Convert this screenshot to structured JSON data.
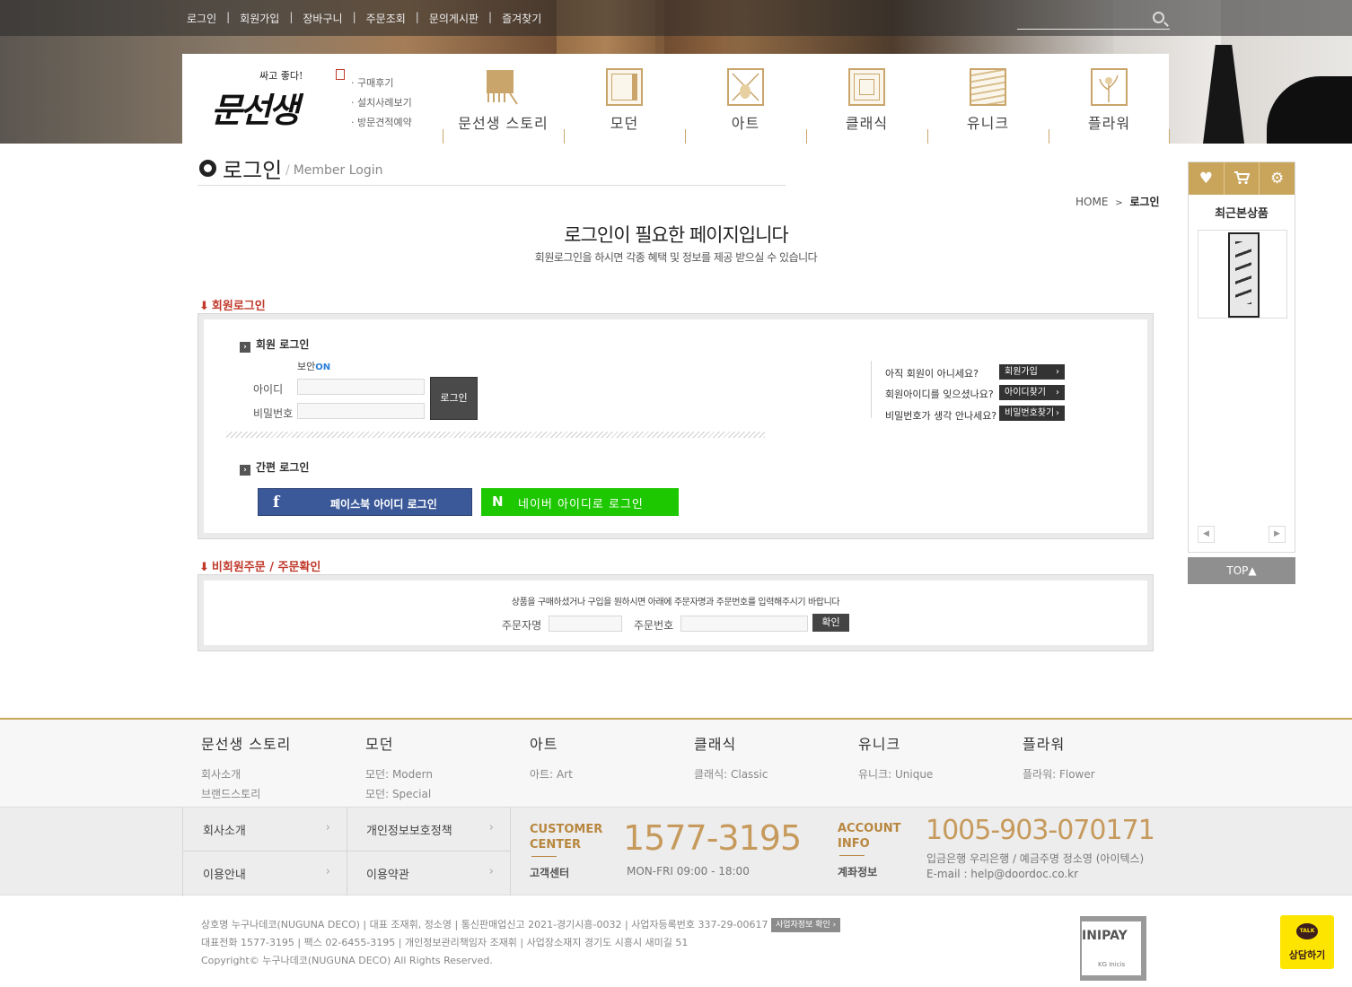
{
  "topnav": {
    "items": [
      "로그인",
      "회원가입",
      "장바구니",
      "주문조회",
      "문의게시판",
      "즐겨찾기"
    ],
    "search_placeholder": ""
  },
  "brand": {
    "slogan": "싸고 좋다!",
    "name": "문선생"
  },
  "quicklinks": [
    "· 구매후기",
    "· 설치사례보기",
    "· 방문견적예약"
  ],
  "categories": [
    "문선생 스토리",
    "모던",
    "아트",
    "클래식",
    "유니크",
    "플라워"
  ],
  "page": {
    "title_ko": "로그인",
    "title_en": "Member Login",
    "title_en_sep": "/",
    "breadcrumb_home": "HOME",
    "breadcrumb_sep": ">",
    "breadcrumb_current": "로그인",
    "headline": "로그인이 필요한 페이지입니다",
    "subline": "회원로그인을 하시면 각종 혜택 및 정보를 제공 받으실 수 있습니다"
  },
  "member_login": {
    "section_label": "회원로그인",
    "sub_title": "회원 로그인",
    "secure_label": "보안",
    "secure_state": "ON",
    "id_label": "아이디",
    "pw_label": "비밀번호",
    "id_value": "",
    "pw_value": "",
    "login_button": "로그인",
    "easy_login_title": "간편 로그인",
    "facebook_button": "페이스북 아이디 로그인",
    "naver_button": "네이버 아이디로 로그인",
    "help": [
      {
        "question": "아직 회원이 아니세요?",
        "button": "회원가입"
      },
      {
        "question": "회원아이디를 잊으셨나요?",
        "button": "아이디찾기"
      },
      {
        "question": "비밀번호가 생각 안나세요?",
        "button": "비밀번호찾기"
      }
    ]
  },
  "guest_order": {
    "section_label": "비회원주문 / 주문확인",
    "message": "상품을 구매하셨거나 구입을 원하시면 아래에 주문자명과 주문번호를 입력해주시기 바랍니다",
    "orderer_label": "주문자명",
    "order_no_label": "주문번호",
    "orderer_value": "",
    "order_no_value": "",
    "confirm_button": "확인"
  },
  "sidebar": {
    "tab_icons": [
      "heart-icon",
      "cart-icon",
      "gear-icon"
    ],
    "recent_title": "최근본상품",
    "prev_arrow": "◀",
    "next_arrow": "▶",
    "top_button": "TOP▲"
  },
  "footer_categories": [
    {
      "title": "문선생 스토리",
      "links": [
        "회사소개",
        "브랜드스토리"
      ]
    },
    {
      "title": "모던",
      "links": [
        "모던: Modern",
        "모던: Special"
      ]
    },
    {
      "title": "아트",
      "links": [
        "아트: Art"
      ]
    },
    {
      "title": "클래식",
      "links": [
        "클래식: Classic"
      ]
    },
    {
      "title": "유니크",
      "links": [
        "유니크: Unique"
      ]
    },
    {
      "title": "플라워",
      "links": [
        "플라워: Flower"
      ]
    }
  ],
  "footer_links": [
    "회사소개",
    "개인정보보호정책",
    "이용안내",
    "이용약관"
  ],
  "customer_center": {
    "label_en_1": "CUSTOMER",
    "label_en_2": "CENTER",
    "label_ko": "고객센터",
    "phone": "1577-3195",
    "hours": "MON-FRI 09:00 - 18:00"
  },
  "account_info": {
    "label_en_1": "ACCOUNT",
    "label_en_2": "INFO",
    "label_ko": "계좌정보",
    "account_no": "1005-903-070171",
    "bank": "입금은행 우리은행 / 예금주명 정소영 (아이텍스)",
    "email": "E-mail : help@doordoc.co.kr"
  },
  "business": {
    "line1": "상호명 누구나데코(NUGUNA DECO) | 대표 조재휘, 정소영 | 통신판매업신고 2021-경기시흥-0032 | 사업자등록번호 337-29-00617",
    "biz_button": "사업자정보 확인",
    "line2": "대표전화 1577-3195 | 팩스 02-6455-3195 | 개인정보관리책임자 조재휘 | 사업장소재지 경기도 시흥시 새미길 51",
    "line3": "Copyright© 누구나데코(NUGUNA DECO) All Rights Reserved."
  },
  "inipay": {
    "name": "INIPAY",
    "sub": "KG Inicis"
  },
  "kakao": {
    "bubble": "TALK",
    "label": "상담하기"
  },
  "colors": {
    "accent": "#c9a45b",
    "alert": "#c0392b",
    "facebook": "#3b5998",
    "naver": "#1ec800",
    "kakao": "#fde500"
  }
}
